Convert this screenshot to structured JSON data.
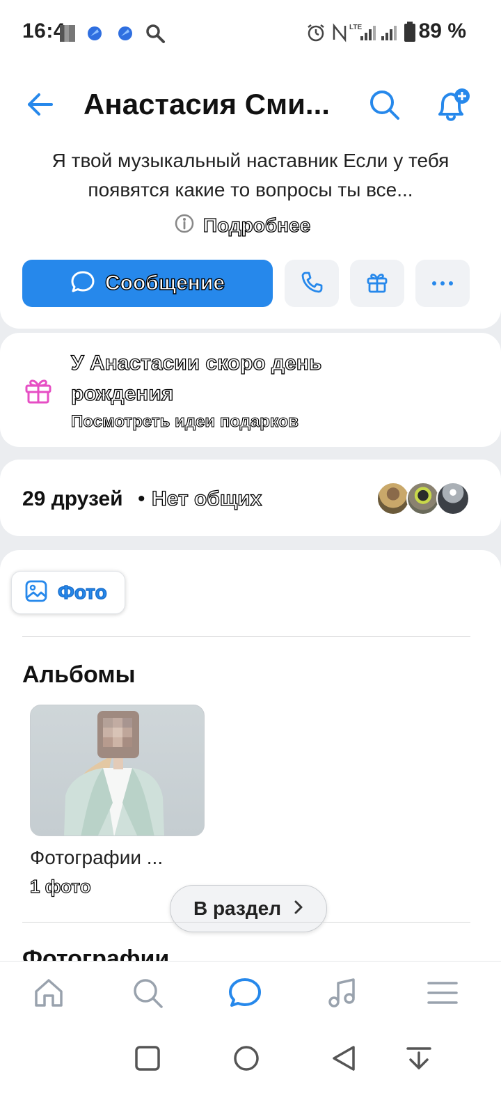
{
  "status_bar": {
    "time": "16:4",
    "battery": "89 %",
    "network": "LTE"
  },
  "header": {
    "title": "Анастасия Сми...",
    "bio": "Я твой музыкальный наставник Если у тебя появятся какие то вопросы ты все...",
    "more_link": "Подробнее"
  },
  "actions": {
    "message_label": "Сообщение"
  },
  "birthday": {
    "title": "У Анастасии скоро день рождения",
    "subtitle": "Посмотреть идеи подарков"
  },
  "friends": {
    "count": "29 друзей",
    "separator": "•",
    "common": "Нет общих"
  },
  "photos": {
    "tab_label": "Фото",
    "albums_title": "Альбомы",
    "album_name": "Фотографии ...",
    "album_count": "1 фото",
    "to_section": "В раздел",
    "photos_title": "Фотографии"
  },
  "tabbar": {
    "items": [
      "home-icon",
      "search-icon",
      "messages-icon",
      "music-icon",
      "menu-icon"
    ],
    "active": "messages-icon"
  },
  "colors": {
    "accent": "#2688eb",
    "gift_pink": "#e64ec4",
    "background": "#ebedf0"
  }
}
